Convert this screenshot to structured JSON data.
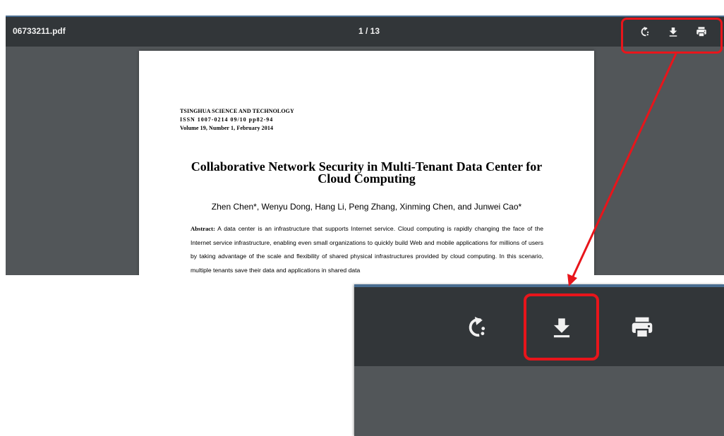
{
  "viewer": {
    "file_name": "06733211.pdf",
    "page_counter": "1 / 13",
    "toolbar": {
      "rotate_icon": "rotate-icon",
      "download_icon": "download-icon",
      "print_icon": "print-icon"
    }
  },
  "document": {
    "journal_lines": [
      "TSINGHUA SCIENCE AND TECHNOLOGY",
      "ISSN  1007-0214  09/10  pp82-94",
      "Volume 19, Number 1, February 2014"
    ],
    "title_lines": [
      "Collaborative Network Security in Multi-Tenant Data Center for",
      "Cloud Computing"
    ],
    "authors": "Zhen Chen*, Wenyu Dong, Hang Li, Peng Zhang, Xinming Chen, and Junwei Cao*",
    "abstract_label": "Abstract:",
    "abstract_text": "A data center is an infrastructure that supports Internet service. Cloud computing is rapidly changing the face of the Internet service infrastructure, enabling even small organizations to quickly build Web and mobile applications for millions of users by taking advantage of the scale and flexibility of shared physical infrastructures provided by cloud computing. In this scenario, multiple tenants save their data and applications in shared data"
  },
  "annotation": {
    "highlight_color": "#e8151b"
  },
  "colors": {
    "toolbar_bg": "#323639",
    "viewer_bg": "#525659",
    "toolbar_text": "#f1f1f1"
  }
}
